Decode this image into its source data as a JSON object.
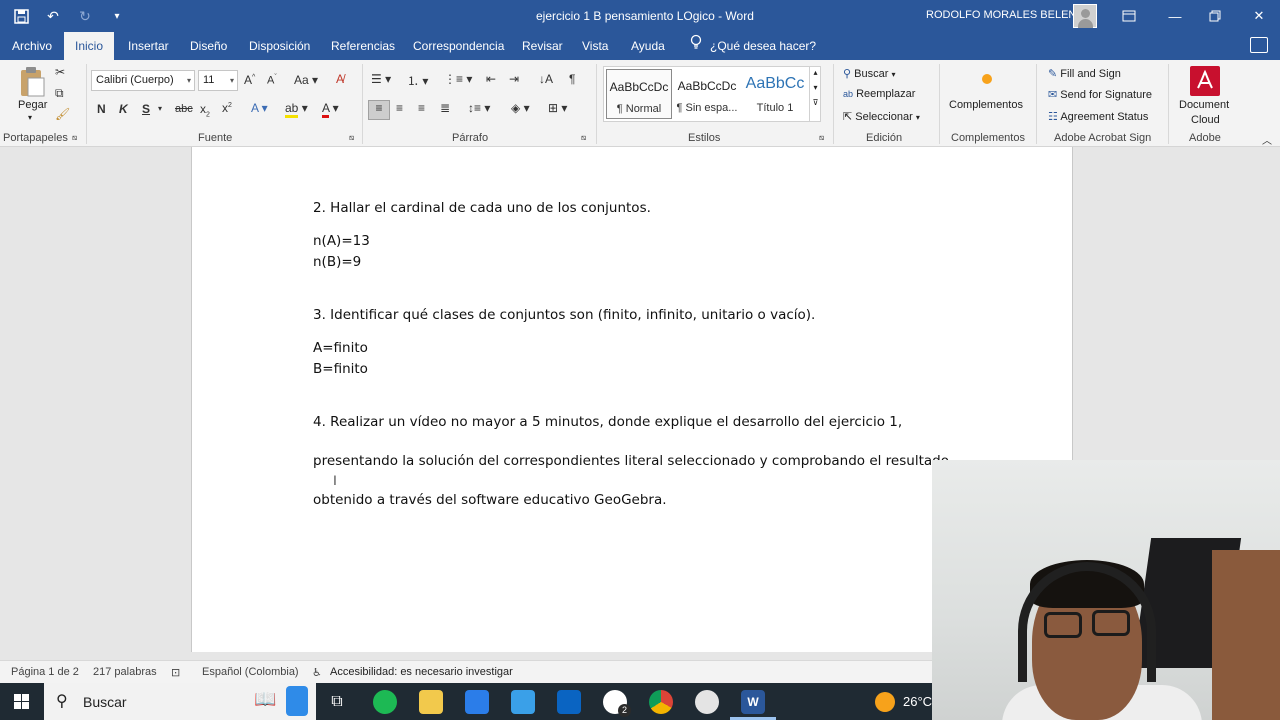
{
  "window": {
    "title": "ejercicio 1 B pensamiento LOgico  -  Word",
    "user": "RODOLFO MORALES BELENO"
  },
  "tabs": [
    {
      "label": "Archivo",
      "active": false
    },
    {
      "label": "Inicio",
      "active": true
    },
    {
      "label": "Insertar",
      "active": false
    },
    {
      "label": "Diseño",
      "active": false
    },
    {
      "label": "Disposición",
      "active": false
    },
    {
      "label": "Referencias",
      "active": false
    },
    {
      "label": "Correspondencia",
      "active": false
    },
    {
      "label": "Revisar",
      "active": false
    },
    {
      "label": "Vista",
      "active": false
    },
    {
      "label": "Ayuda",
      "active": false
    }
  ],
  "tell_me": "¿Qué desea hacer?",
  "ribbon": {
    "clipboard": {
      "paste_label": "Pegar",
      "group": "Portapapeles"
    },
    "font": {
      "name": "Calibri (Cuerpo)",
      "size": "11",
      "group": "Fuente"
    },
    "paragraph": {
      "group": "Párrafo"
    },
    "styles": {
      "group": "Estilos",
      "items": [
        {
          "preview": "AaBbCcDc",
          "name": "¶ Normal"
        },
        {
          "preview": "AaBbCcDc",
          "name": "¶ Sin espa..."
        },
        {
          "preview": "AaBbCc",
          "name": "Título 1"
        }
      ]
    },
    "editing": {
      "find": "Buscar",
      "replace": "Reemplazar",
      "select": "Seleccionar",
      "group": "Edición"
    },
    "addins": {
      "label": "Complementos",
      "group": "Complementos"
    },
    "acrobat": {
      "fill_sign": "Fill and Sign",
      "send_signature": "Send for Signature",
      "agreement_status": "Agreement Status",
      "group": "Adobe Acrobat Sign"
    },
    "adobe": {
      "doc_cloud_1": "Document",
      "doc_cloud_2": "Cloud",
      "group": "Adobe"
    }
  },
  "document": {
    "lines": [
      "2. Hallar el cardinal de cada uno de los conjuntos.",
      "n(A)=13",
      "n(B)=9",
      "3. Identificar qué clases de conjuntos son (finito, infinito, unitario o vacío).",
      "A=finito",
      "B=finito",
      "4. Realizar un vídeo no mayor a 5 minutos, donde explique el desarrollo del ejercicio 1,",
      "presentando la solución del correspondientes literal seleccionado y comprobando el resultado",
      "obtenido a través del software educativo GeoGebra."
    ]
  },
  "status": {
    "page": "Página 1 de 2",
    "words": "217 palabras",
    "language": "Español (Colombia)",
    "accessibility": "Accesibilidad: es necesario investigar"
  },
  "taskbar": {
    "search": "Buscar",
    "temperature": "26°C",
    "chrome_badge": "2"
  },
  "colors": {
    "word_blue": "#2b579a",
    "taskbar": "#1f2a33",
    "ribbon_bg": "#f3f3f3"
  }
}
